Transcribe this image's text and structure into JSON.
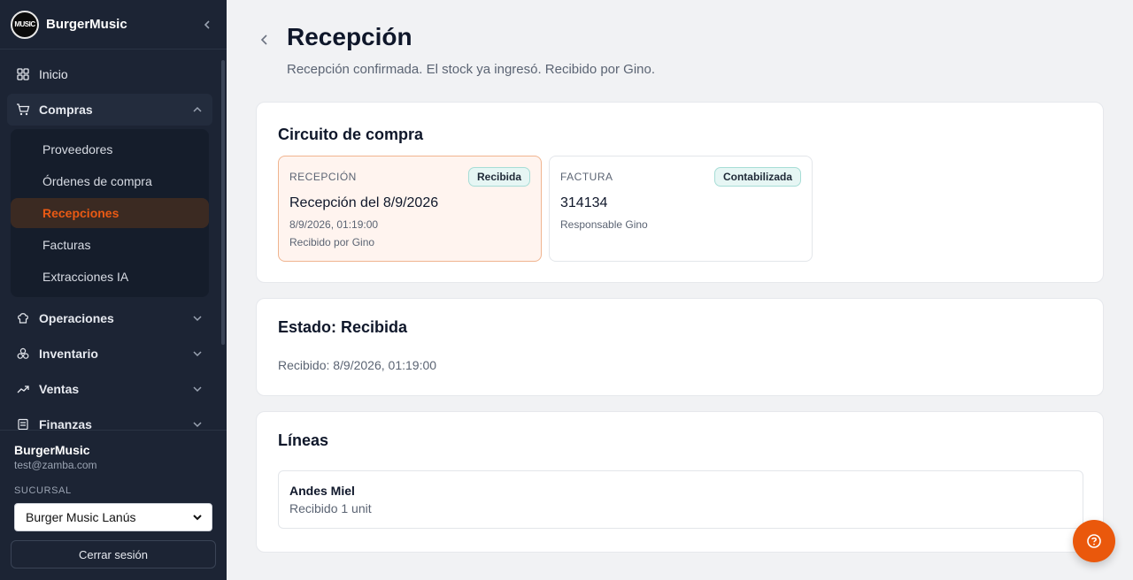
{
  "brand": {
    "name": "BurgerMusic",
    "logo_text": "MUSIC"
  },
  "sidebar": {
    "items": [
      {
        "label": "Inicio",
        "icon": "dashboard-icon"
      },
      {
        "label": "Compras",
        "icon": "cart-icon",
        "expanded": true,
        "children": [
          "Proveedores",
          "Órdenes de compra",
          "Recepciones",
          "Facturas",
          "Extracciones IA"
        ],
        "active_child": "Recepciones"
      },
      {
        "label": "Operaciones",
        "icon": "chef-hat-icon"
      },
      {
        "label": "Inventario",
        "icon": "boxes-icon"
      },
      {
        "label": "Ventas",
        "icon": "trend-icon"
      },
      {
        "label": "Finanzas",
        "icon": "receipt-icon"
      }
    ]
  },
  "footer": {
    "business": "BurgerMusic",
    "email": "test@zamba.com",
    "branch_label": "SUCURSAL",
    "branch_value": "Burger Music Lanús",
    "logout": "Cerrar sesión"
  },
  "page": {
    "title": "Recepción",
    "subtitle": "Recepción confirmada. El stock ya ingresó. Recibido por Gino."
  },
  "circuit": {
    "title": "Circuito de compra",
    "steps": [
      {
        "kind": "RECEPCIÓN",
        "badge": "Recibida",
        "value": "Recepción del 8/9/2026",
        "meta1": "8/9/2026, 01:19:00",
        "meta2": "Recibido por Gino"
      },
      {
        "kind": "FACTURA",
        "badge": "Contabilizada",
        "value": "314134",
        "meta1": "Responsable Gino",
        "meta2": ""
      }
    ]
  },
  "status": {
    "title": "Estado: Recibida",
    "received": "Recibido: 8/9/2026, 01:19:00"
  },
  "lines": {
    "title": "Líneas",
    "items": [
      {
        "name": "Andes Miel",
        "qty": "Recibido 1 unit"
      }
    ]
  },
  "colors": {
    "accent": "#ea580c",
    "sidebar_bg": "#1c2434"
  }
}
